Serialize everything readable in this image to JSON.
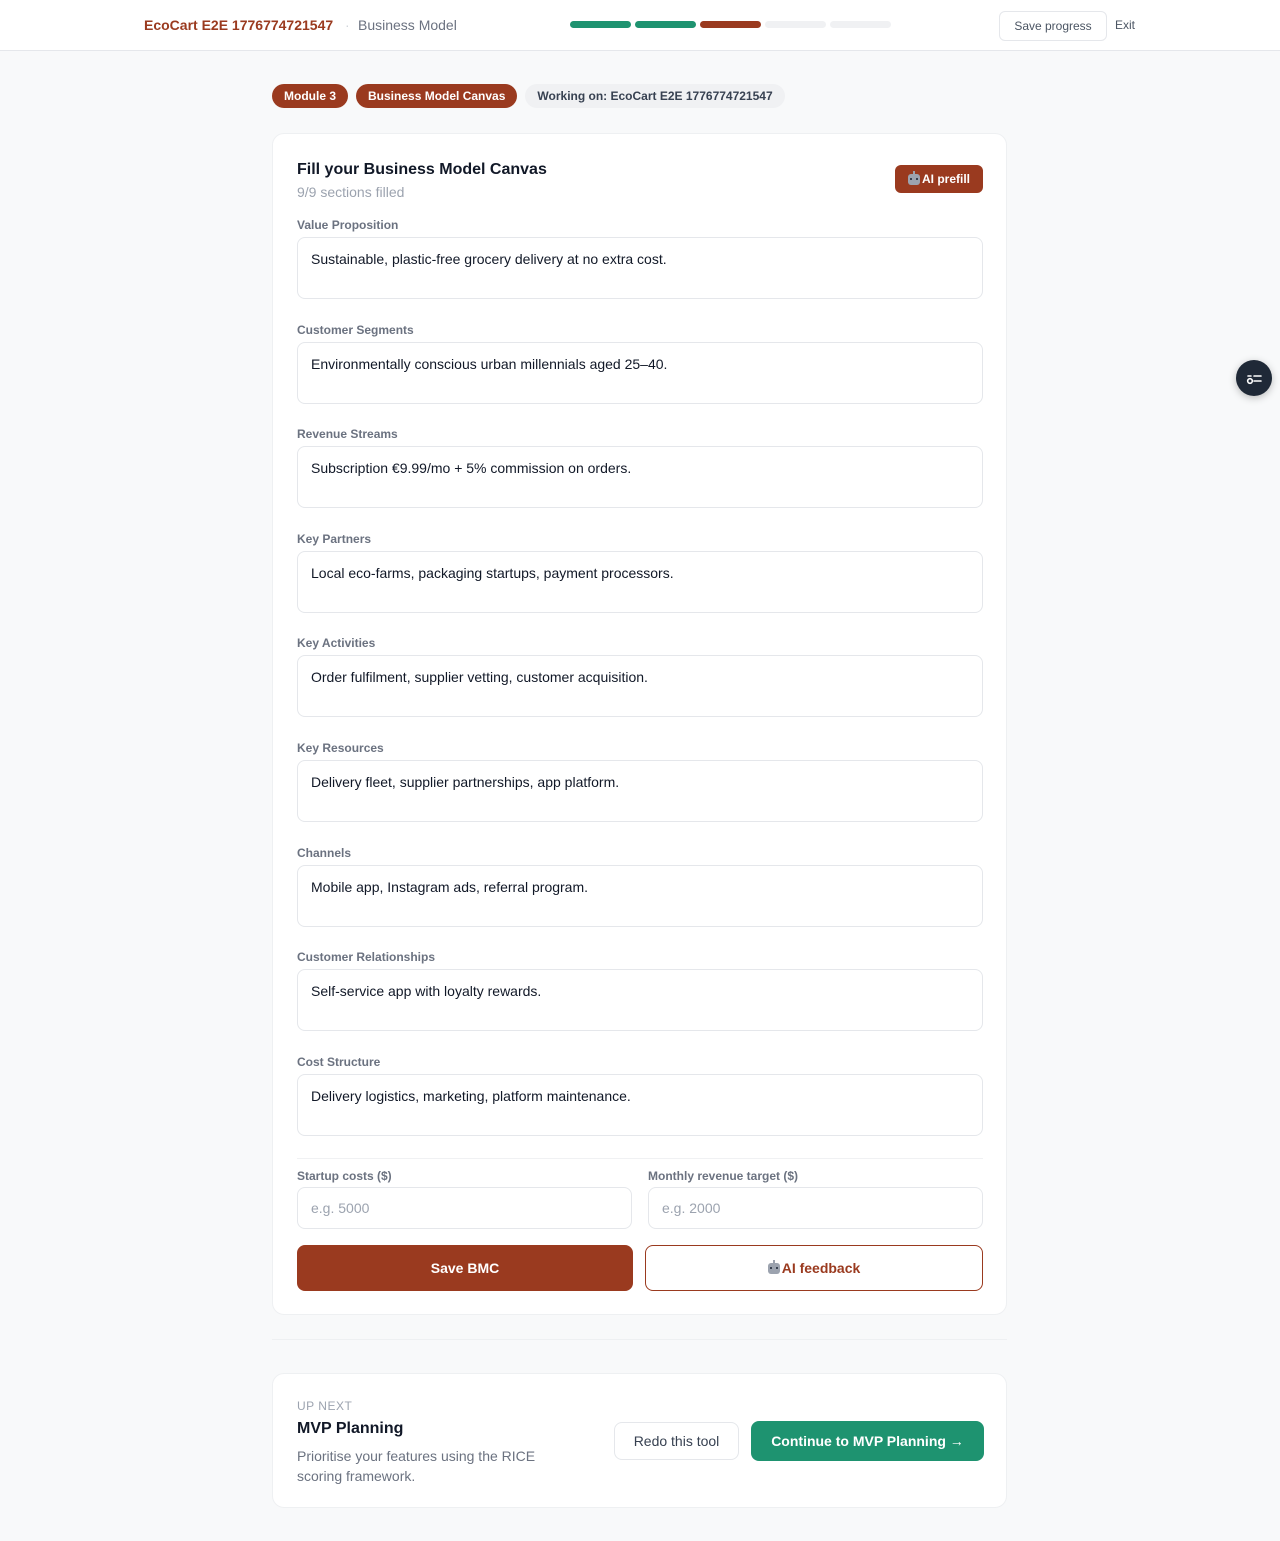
{
  "header": {
    "brand": "EcoCart E2E 1776774721547",
    "separator": "·",
    "section": "Business Model",
    "progress": {
      "completed": 2,
      "current": 3,
      "total": 5
    },
    "save_progress_label": "Save progress",
    "exit_label": "Exit"
  },
  "pills": {
    "module": "Module 3",
    "tool": "Business Model Canvas",
    "working_on": "Working on: EcoCart E2E 1776774721547"
  },
  "canvas": {
    "title": "Fill your Business Model Canvas",
    "subtitle": "9/9 sections filled",
    "prefill_label": "AI prefill",
    "fields": [
      {
        "label": "Value Proposition",
        "value": "Sustainable, plastic-free grocery delivery at no extra cost."
      },
      {
        "label": "Customer Segments",
        "value": "Environmentally conscious urban millennials aged 25–40."
      },
      {
        "label": "Revenue Streams",
        "value": "Subscription €9.99/mo + 5% commission on orders."
      },
      {
        "label": "Key Partners",
        "value": "Local eco-farms, packaging startups, payment processors."
      },
      {
        "label": "Key Activities",
        "value": "Order fulfilment, supplier vetting, customer acquisition."
      },
      {
        "label": "Key Resources",
        "value": "Delivery fleet, supplier partnerships, app platform."
      },
      {
        "label": "Channels",
        "value": "Mobile app, Instagram ads, referral program."
      },
      {
        "label": "Customer Relationships",
        "value": "Self-service app with loyalty rewards."
      },
      {
        "label": "Cost Structure",
        "value": "Delivery logistics, marketing, platform maintenance."
      }
    ],
    "startup_costs_label": "Startup costs ($)",
    "startup_costs_placeholder": "e.g. 5000",
    "revenue_target_label": "Monthly revenue target ($)",
    "revenue_target_placeholder": "e.g. 2000",
    "save_label": "Save BMC",
    "feedback_label": "AI feedback"
  },
  "next": {
    "eyebrow": "UP NEXT",
    "title": "MVP Planning",
    "description": "Prioritise your features using the RICE scoring framework.",
    "redo_label": "Redo this tool",
    "continue_label": "Continue to MVP Planning →"
  },
  "colors": {
    "brand": "#9a3a1f",
    "success": "#1e9370",
    "step_done": "#1e9370",
    "step_current": "#9a3a1f",
    "step_todo": "#f0f1f3"
  }
}
